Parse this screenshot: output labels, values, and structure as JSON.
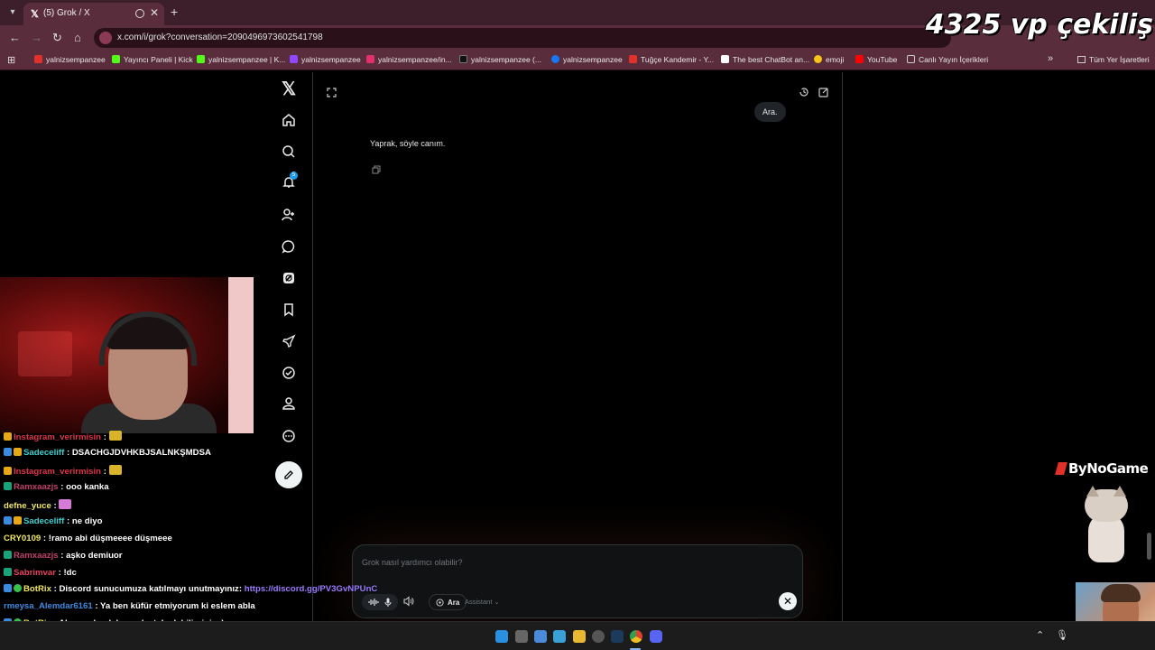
{
  "browser": {
    "tab_title": "(5) Grok / X",
    "tab_favicon": "𝕏",
    "new_tab_label": "+",
    "tab_close_label": "✕",
    "url": "x.com/i/grok?conversation=2090496973602541798",
    "bookmarks": [
      {
        "label": "yalnizsempanzee",
        "color": "#e0322a"
      },
      {
        "label": "Yayıncı Paneli | Kick",
        "color": "#53fc18"
      },
      {
        "label": "yalnizsempanzee | K...",
        "color": "#53fc18"
      },
      {
        "label": "yalnizsempanzee",
        "color": "#9146ff"
      },
      {
        "label": "yalnizsempanzee/in...",
        "color": "#e1306c"
      },
      {
        "label": "yalnizsempanzee (...",
        "color": "#111111"
      },
      {
        "label": "yalnizsempanzee",
        "color": "#1877f2"
      },
      {
        "label": "Tuğçe Kandemir - Y...",
        "color": "#e0322a"
      },
      {
        "label": "The best ChatBot an...",
        "color": "#ffffff"
      },
      {
        "label": "emoji",
        "color": "#f5c518"
      },
      {
        "label": "YouTube",
        "color": "#ff0000"
      },
      {
        "label": "Canlı Yayın İçerikleri",
        "color": "#999999"
      }
    ],
    "all_bookmarks_label": "Tüm Yer İşaretleri"
  },
  "overlay": {
    "headline": "4325 vp çekiliş",
    "brand": "ByNoGame"
  },
  "x_nav": {
    "logo": "𝕏",
    "notification_count": "5",
    "items": [
      "home-icon",
      "search-icon",
      "bell-icon",
      "add-user-icon",
      "messages-icon",
      "grok-icon",
      "bookmark-icon",
      "rocket-icon",
      "verified-icon",
      "profile-icon",
      "more-icon"
    ],
    "compose_icon": "compose-icon"
  },
  "grok": {
    "user_message": "Ara.",
    "assistant_message": "Yaprak, söyle canım.",
    "composer": {
      "placeholder": "Grok nasıl yardımcı olabilir?",
      "search_label": "Ara",
      "mode_label": "Assistant",
      "close_label": "✕"
    }
  },
  "chat": [
    {
      "user": "Instagram_verirmisin",
      "color": "#e0324a",
      "badges": [
        "sub"
      ],
      "message": "",
      "emote": "gold"
    },
    {
      "user": "Sadeceliff",
      "color": "#3ad0d0",
      "badges": [
        "mod",
        "sub"
      ],
      "message": "DSACHGJDVHKBJSALNKŞMDSA",
      "emote": ""
    },
    {
      "user": "Instagram_verirmisin",
      "color": "#e0324a",
      "badges": [
        "sub"
      ],
      "message": "",
      "emote": "gold"
    },
    {
      "user": "Ramxaazjs",
      "color": "#c0406a",
      "badges": [
        "vip"
      ],
      "message": "ooo kanka",
      "emote": ""
    },
    {
      "user": "defne_yuce",
      "color": "#f0e860",
      "badges": [],
      "message": "",
      "emote": "pink"
    },
    {
      "user": "Sadeceliff",
      "color": "#3ad0d0",
      "badges": [
        "mod",
        "sub"
      ],
      "message": "ne diyo",
      "emote": ""
    },
    {
      "user": "CRY0109",
      "color": "#f0e860",
      "badges": [],
      "message": "!ramo abi düşmeeee düşmeee",
      "emote": ""
    },
    {
      "user": "Ramxaazjs",
      "color": "#c0406a",
      "badges": [
        "vip"
      ],
      "message": "aşko demiuor",
      "emote": ""
    },
    {
      "user": "Sabrimvar",
      "color": "#e84060",
      "badges": [
        "vip"
      ],
      "message": "!dc",
      "emote": ""
    },
    {
      "user": "BotRix",
      "color": "#f0e860",
      "badges": [
        "mod",
        "bot"
      ],
      "message": "Discord sunucumuza katılmayı unutmayınız: ",
      "link": "https://discord.gg/PV3GvNPUnC",
      "emote": ""
    },
    {
      "user": "rmeysa_Alemdar6161",
      "color": "#3a8be0",
      "badges": [],
      "message": "Ya ben küfür etmiyorum ki eslem abla",
      "emote": ""
    },
    {
      "user": "BotRix",
      "color": "#f0e860",
      "badges": [
        "mod",
        "bot"
      ],
      "message": "Abone olarak bana destek olabilirsiniz ;)",
      "emote": ""
    }
  ]
}
